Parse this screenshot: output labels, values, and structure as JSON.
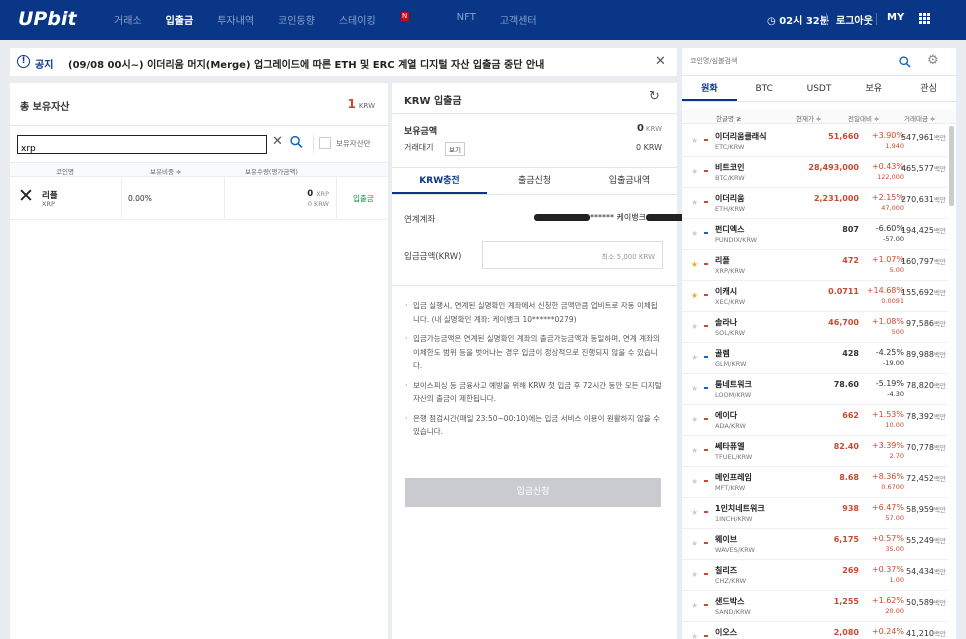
{
  "header": {
    "logo": "UPbit",
    "nav": [
      {
        "label": "거래소"
      },
      {
        "label": "입출금",
        "active": true
      },
      {
        "label": "투자내역"
      },
      {
        "label": "코인동향"
      },
      {
        "label": "스테이킹",
        "badge": "N"
      },
      {
        "label": "NFT"
      },
      {
        "label": "고객센터"
      }
    ],
    "timer": "02시 32분",
    "logout": "로그아웃",
    "my": "MY",
    "colors": {
      "bar": "#093687"
    }
  },
  "notice": {
    "label": "공지",
    "text": "(09/08 00시~) 이더리움 머지(Merge) 업그레이드에 따른 ETH 및 ERC 계열 디지털 자산 입출금 중단 안내"
  },
  "assets": {
    "title": "총 보유자산",
    "total": "1",
    "total_unit": "KRW",
    "search_value": "xrp",
    "held_only_label": "보유자산만",
    "columns": [
      "코인명",
      "보유비중 ≑",
      "보유수량(평가금액)"
    ],
    "rows": [
      {
        "name": "리플",
        "code": "XRP",
        "ratio": "0.00%",
        "qty": "0",
        "qty_unit": "XRP",
        "krw": "0 KRW",
        "action": "입출금"
      }
    ]
  },
  "krw": {
    "title": "KRW 입출금",
    "holding_label": "보유금액",
    "holding_value": "0",
    "holding_unit": "KRW",
    "waiting_label": "거래대기",
    "waiting_button": "보기",
    "waiting_value": "0 KRW",
    "tabs": [
      "KRW충전",
      "출금신청",
      "입출금내역"
    ],
    "account_label": "연계계좌",
    "account_mask": "******",
    "account_bank": "케이뱅크",
    "deposit_label": "입금금액(KRW)",
    "deposit_placeholder": "최소 5,000 KRW",
    "notes": [
      "입금 실행시, 연계된 실명확인 계좌에서 신청한 금액만큼 업비트로 자동 이체됩니다. (내 실명확인 계좌: 케이뱅크 10******0279)",
      "입금가능금액은 연계된 실명확인 계좌의 출금가능금액과 동일하며, 연계 계좌의 이체한도 범위 등을 벗어나는 경우 입금이 정상적으로 진행되지 않을 수 있습니다.",
      "보이스피싱 등 금융사고 예방을 위해 KRW 첫 입금 후 72시간 동안 모든 디지털 자산의 출금이 제한됩니다.",
      "은행 점검시간(매일 23:50~00:10)에는 입금 서비스 이용이 원활하지 않을 수 있습니다."
    ],
    "submit": "입금신청"
  },
  "market": {
    "search_placeholder": "코인명/심볼검색",
    "tabs": [
      "원화",
      "BTC",
      "USDT",
      "보유",
      "관심"
    ],
    "columns": [
      "한글명 ≵",
      "현재가 ≑",
      "전일대비 ≑",
      "거래대금 ≑"
    ],
    "unit": "백만",
    "colors": {
      "up": "#c84a31",
      "down": "#1261c4"
    },
    "rows": [
      {
        "name": "이더리움클래식",
        "pair": "ETC/KRW",
        "price": "51,660",
        "change": "+3.90%",
        "diff": "1,940",
        "volume": "547,961",
        "dir": "up",
        "star": false
      },
      {
        "name": "비트코인",
        "pair": "BTC/KRW",
        "price": "28,493,000",
        "change": "+0.43%",
        "diff": "122,000",
        "volume": "465,577",
        "dir": "up",
        "star": false
      },
      {
        "name": "이더리움",
        "pair": "ETH/KRW",
        "price": "2,231,000",
        "change": "+2.15%",
        "diff": "47,000",
        "volume": "270,631",
        "dir": "up",
        "star": false
      },
      {
        "name": "펀디엑스",
        "pair": "PUNDIX/KRW",
        "price": "807",
        "change": "-6.60%",
        "diff": "-57.00",
        "volume": "194,425",
        "dir": "down",
        "star": false
      },
      {
        "name": "리플",
        "pair": "XRP/KRW",
        "price": "472",
        "change": "+1.07%",
        "diff": "5.00",
        "volume": "160,797",
        "dir": "up",
        "star": true
      },
      {
        "name": "이캐시",
        "pair": "XEC/KRW",
        "price": "0.0711",
        "change": "+14.68%",
        "diff": "0.0091",
        "volume": "155,692",
        "dir": "up",
        "star": true
      },
      {
        "name": "솔라나",
        "pair": "SOL/KRW",
        "price": "46,700",
        "change": "+1.08%",
        "diff": "500",
        "volume": "97,586",
        "dir": "up",
        "star": false
      },
      {
        "name": "골렘",
        "pair": "GLM/KRW",
        "price": "428",
        "change": "-4.25%",
        "diff": "-19.00",
        "volume": "89,988",
        "dir": "down",
        "star": false
      },
      {
        "name": "룸네트워크",
        "pair": "LOOM/KRW",
        "price": "78.60",
        "change": "-5.19%",
        "diff": "-4.30",
        "volume": "78,820",
        "dir": "down",
        "star": false
      },
      {
        "name": "에이다",
        "pair": "ADA/KRW",
        "price": "662",
        "change": "+1.53%",
        "diff": "10.00",
        "volume": "78,392",
        "dir": "up",
        "star": false
      },
      {
        "name": "쎄타퓨엘",
        "pair": "TFUEL/KRW",
        "price": "82.40",
        "change": "+3.39%",
        "diff": "2.70",
        "volume": "70,778",
        "dir": "up",
        "star": false
      },
      {
        "name": "메인프레임",
        "pair": "MFT/KRW",
        "price": "8.68",
        "change": "+8.36%",
        "diff": "0.6700",
        "volume": "72,452",
        "dir": "up",
        "star": false
      },
      {
        "name": "1인치네트워크",
        "pair": "1INCH/KRW",
        "price": "938",
        "change": "+6.47%",
        "diff": "57.00",
        "volume": "58,959",
        "dir": "up",
        "star": false
      },
      {
        "name": "웨이브",
        "pair": "WAVES/KRW",
        "price": "6,175",
        "change": "+0.57%",
        "diff": "35.00",
        "volume": "55,249",
        "dir": "up",
        "star": false
      },
      {
        "name": "칠리즈",
        "pair": "CHZ/KRW",
        "price": "269",
        "change": "+0.37%",
        "diff": "1.00",
        "volume": "54,434",
        "dir": "up",
        "star": false
      },
      {
        "name": "샌드박스",
        "pair": "SAND/KRW",
        "price": "1,255",
        "change": "+1.62%",
        "diff": "20.00",
        "volume": "50,589",
        "dir": "up",
        "star": false
      },
      {
        "name": "이오스",
        "pair": "EOS/KRW",
        "price": "2,080",
        "change": "+0.24%",
        "diff": "5.00",
        "volume": "41,210",
        "dir": "up",
        "star": false
      }
    ]
  }
}
